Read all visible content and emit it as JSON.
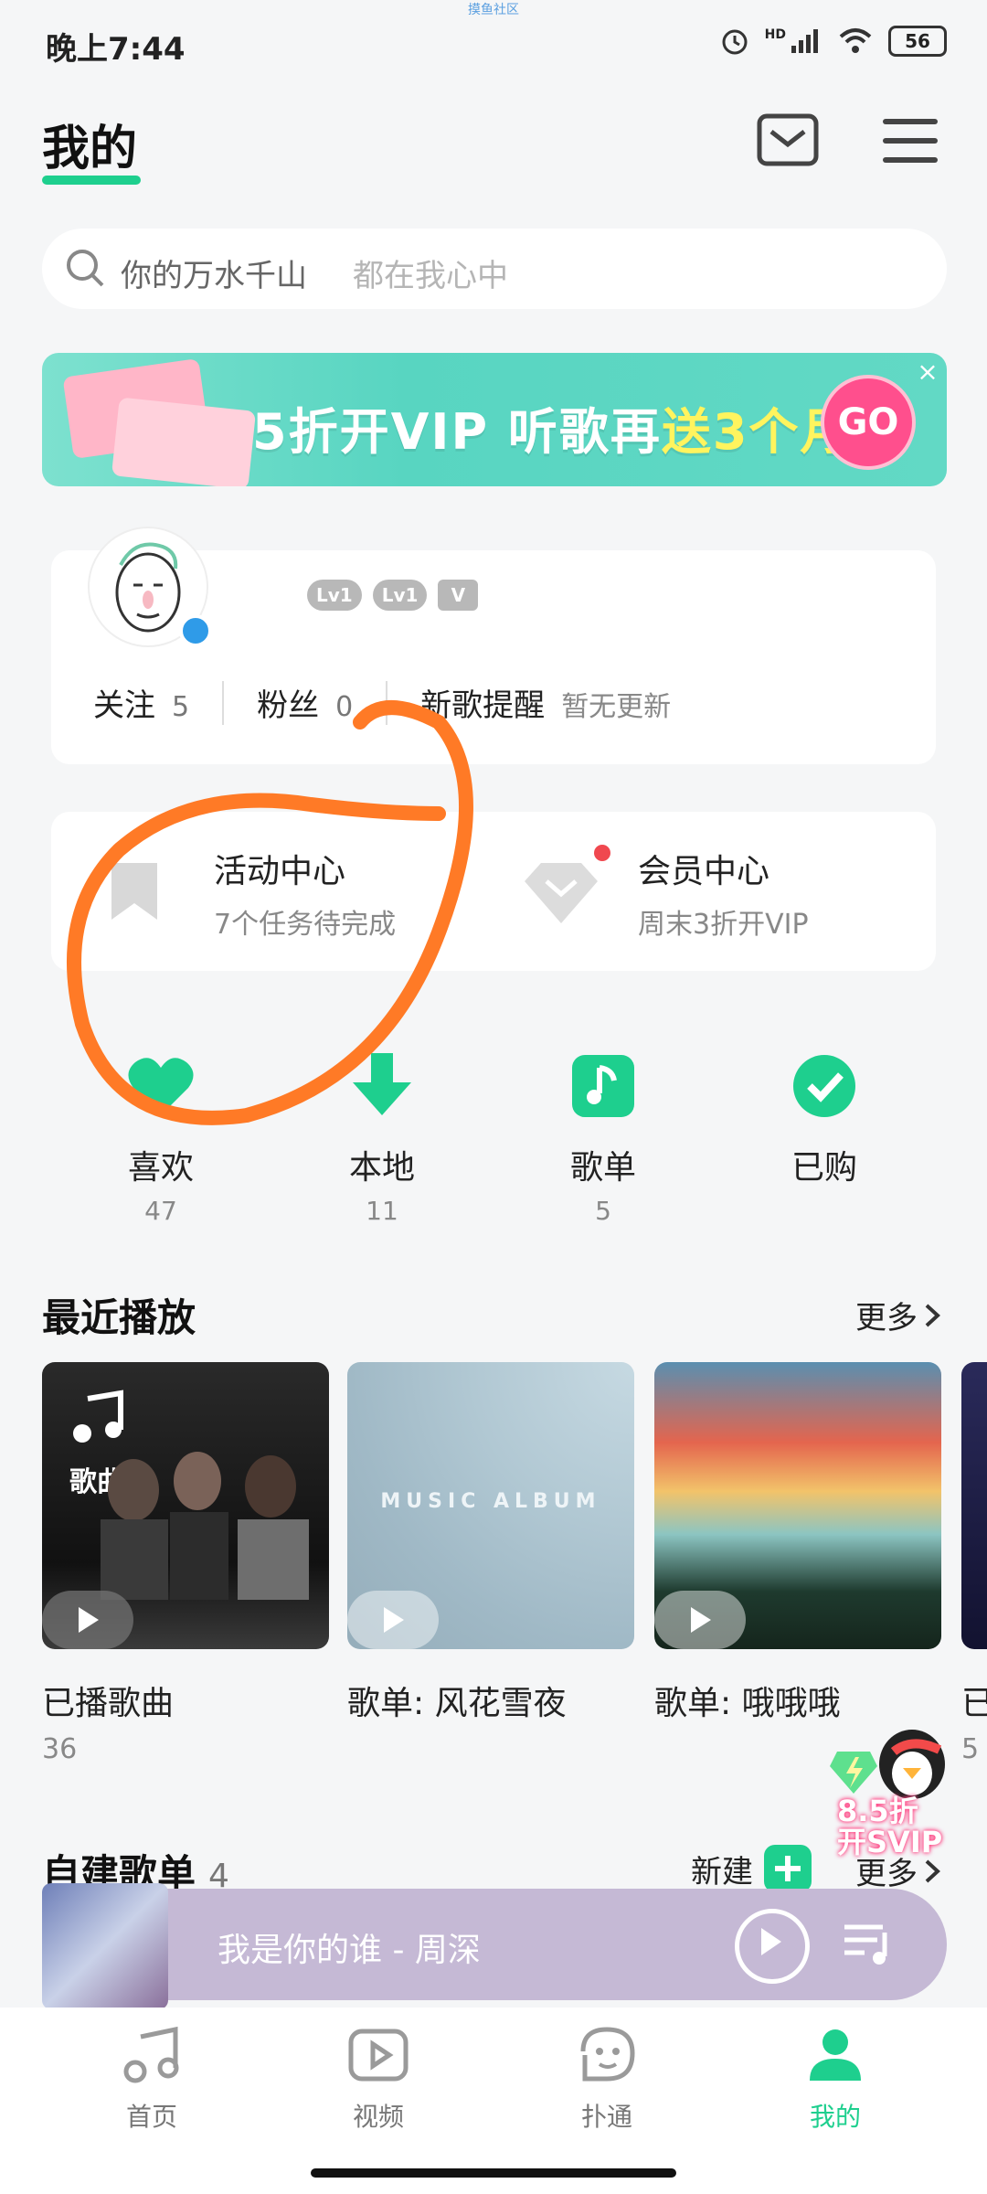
{
  "status": {
    "time": "晚上7:44",
    "faint_top": "摸鱼社区",
    "battery": "56",
    "hd": "HD"
  },
  "header": {
    "title": "我的"
  },
  "search": {
    "main": "你的万水千山",
    "sub": "都在我心中"
  },
  "banner": {
    "text_a": "5折开VIP 听歌再",
    "text_b": "送3个月",
    "go": "GO",
    "close": "×"
  },
  "profile": {
    "badges": [
      "Lv1",
      "Lv1",
      "V"
    ],
    "follow_label": "关注",
    "follow_count": "5",
    "fans_label": "粉丝",
    "fans_count": "0",
    "newsong_label": "新歌提醒",
    "newsong_status": "暂无更新"
  },
  "features": {
    "activity": {
      "title": "活动中心",
      "sub": "7个任务待完成"
    },
    "member": {
      "title": "会员中心",
      "sub": "周末3折开VIP"
    }
  },
  "quick": [
    {
      "label": "喜欢",
      "count": "47"
    },
    {
      "label": "本地",
      "count": "11"
    },
    {
      "label": "歌单",
      "count": "5"
    },
    {
      "label": "已购",
      "count": ""
    }
  ],
  "recent": {
    "title": "最近播放",
    "more": "更多",
    "cards": [
      {
        "title": "已播歌曲",
        "count": "36",
        "overlay": "歌曲"
      },
      {
        "title": "歌单: 风花雪夜",
        "count": "",
        "overlay": "MUSIC ALBUM"
      },
      {
        "title": "歌单: 哦哦哦",
        "count": ""
      },
      {
        "title": "已",
        "count": "5"
      }
    ]
  },
  "playlists": {
    "title": "自建歌单",
    "count": "4",
    "new": "新建",
    "more": "更多"
  },
  "promo": {
    "line1": "8.5折",
    "line2": "开SVIP"
  },
  "player": {
    "track": "我是你的谁 - 周深"
  },
  "nav": [
    {
      "label": "首页"
    },
    {
      "label": "视频"
    },
    {
      "label": "扑通"
    },
    {
      "label": "我的"
    }
  ],
  "colors": {
    "accent": "#1ecf8e",
    "annotation": "#ff7a26"
  }
}
